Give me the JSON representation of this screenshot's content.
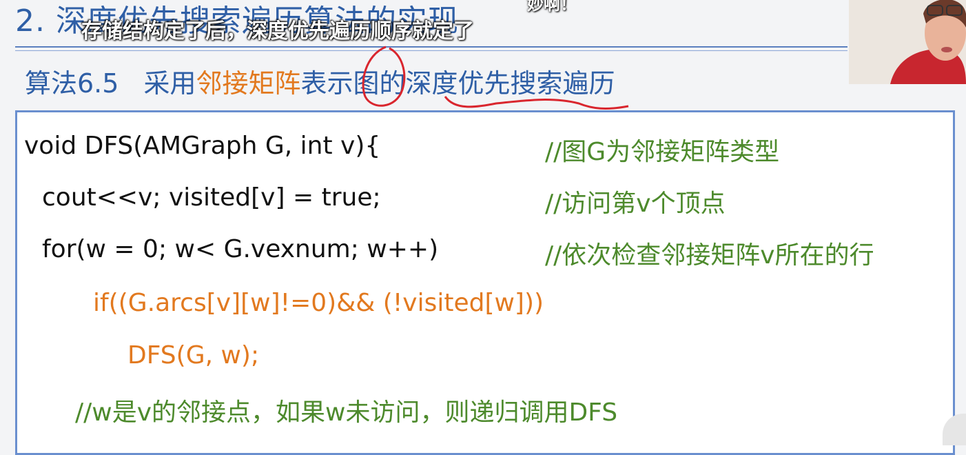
{
  "slide": {
    "title": "2. 深度优先搜索遍历算法的实现",
    "subtitle_caption": "存储结构定了后，深度优先遍历顺序就定了",
    "danmaku": "妙啊！"
  },
  "algorithm": {
    "number": "算法6.5",
    "text_before": "采用",
    "highlight": "邻接矩阵",
    "text_after": "表示图的深度优先搜索遍历"
  },
  "code": {
    "lines": [
      "void DFS(AMGraph G, int v){",
      "cout<<v;  visited[v] = true;",
      "for(w = 0; w< G.vexnum; w++)",
      "if((G.arcs[v][w]!=0)&& (!visited[w]))",
      "DFS(G, w);"
    ],
    "comments": [
      "//图G为邻接矩阵类型",
      "//访问第v个顶点",
      "//依次检查邻接矩阵v所在的行",
      "//w是v的邻接点，如果w未访问，则递归调用DFS"
    ]
  },
  "colors": {
    "title_blue": "#2f5fa6",
    "highlight_orange": "#e2791f",
    "comment_green": "#4d8a2c",
    "annotation_red": "#d9262e"
  }
}
